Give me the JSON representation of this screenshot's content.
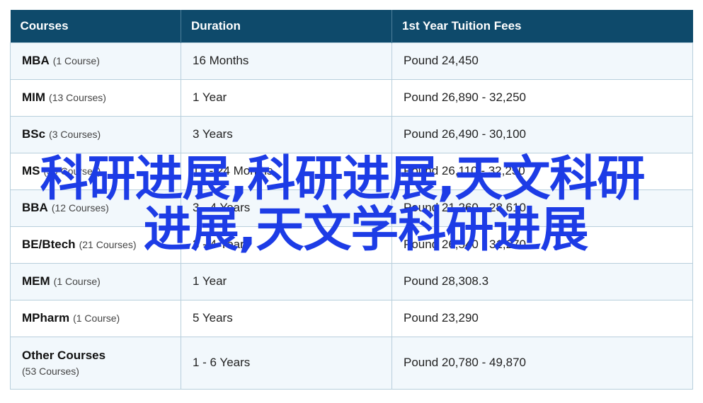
{
  "table": {
    "headers": [
      "Courses",
      "Duration",
      "1st Year Tuition Fees"
    ],
    "rows": [
      {
        "course": "MBA",
        "count": "(1 Course)",
        "duration": "16 Months",
        "fee": "Pound 24,450"
      },
      {
        "course": "MIM",
        "count": "(13 Courses)",
        "duration": "1 Year",
        "fee": "Pound 26,890 - 32,250"
      },
      {
        "course": "BSc",
        "count": "(3 Courses)",
        "duration": "3 Years",
        "fee": "Pound 26,490 - 30,100"
      },
      {
        "course": "MS",
        "count": "(39 Courses)",
        "duration": "12 - 24 Months",
        "fee": "Pound 26,110 - 32,250"
      },
      {
        "course": "BBA",
        "count": "(12 Courses)",
        "duration": "3 - 4 Years",
        "fee": "Pound 21,260 - 28,610"
      },
      {
        "course": "BE/Btech",
        "count": "(21 Courses)",
        "duration": "3 - 4 Years",
        "fee": "Pound 26,540 - 31,270"
      },
      {
        "course": "MEM",
        "count": "(1 Course)",
        "duration": "1 Year",
        "fee": "Pound 28,308.3"
      },
      {
        "course": "MPharm",
        "count": "(1 Course)",
        "duration": "5 Years",
        "fee": "Pound 23,290"
      },
      {
        "course": "Other Courses",
        "count": "(53 Courses)",
        "duration": "1 - 6 Years",
        "fee": "Pound 20,780 - 49,870"
      }
    ]
  },
  "watermark": {
    "line1": "科研进展,科研进展,天文科研",
    "line2": "进展,天文学科研进展"
  },
  "colors": {
    "header_bg": "#0e4a6b",
    "row_alt_bg": "#f2f8fc",
    "border": "#b8cfdc",
    "watermark": "#1d3ce6"
  }
}
